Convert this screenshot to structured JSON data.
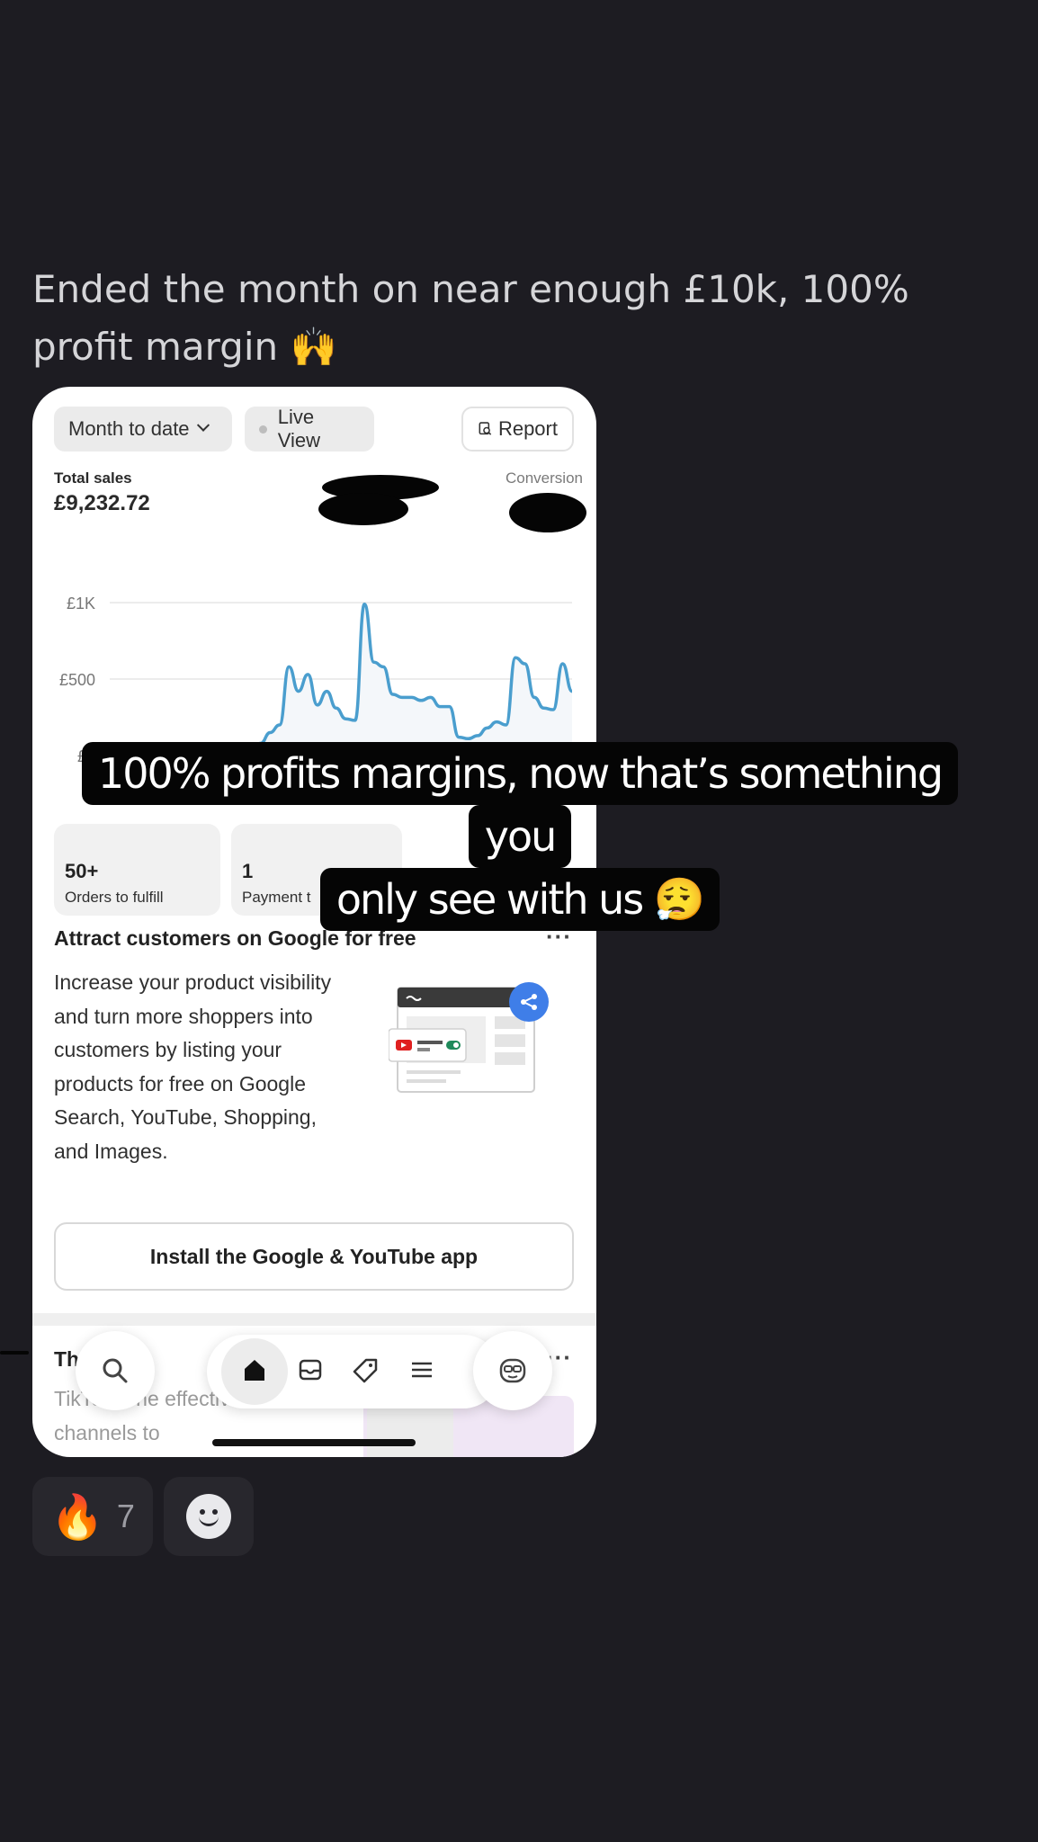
{
  "post": {
    "text": "Ended the month on near enough £10k, 100% profit margin 🙌"
  },
  "dashboard": {
    "filters": {
      "period_label": "Month to date",
      "live_label": "Live View",
      "report_label": "Report"
    },
    "total_sales_label": "Total sales",
    "total_sales_value": "£9,232.72",
    "conversion_label": "Conversion",
    "stats": [
      {
        "value": "50+",
        "label": "Orders to fulfill"
      },
      {
        "value": "1",
        "label": "Payment t"
      }
    ],
    "attract_card": {
      "title": "Attract customers on Google for free",
      "more": "···",
      "body": "Increase your product visibility and turn more shoppers into customers by listing your products for free on Google Search, YouTube, Shopping, and Images.",
      "button_label": "Install the Google & YouTube app"
    },
    "tiktok_card": {
      "title": "Th",
      "body": "TikTo s one   effective social channels to"
    },
    "tabs": [
      "search-icon",
      "home-icon",
      "inbox-icon",
      "tag-icon",
      "menu-icon",
      "avatar-icon"
    ]
  },
  "chart_data": {
    "type": "line",
    "title": "",
    "xlabel": "",
    "ylabel": "",
    "y_ticks": [
      "£0",
      "£500",
      "£1K"
    ],
    "ylim": [
      0,
      1000
    ],
    "grid": true,
    "series": [
      {
        "color": "#4a9ece",
        "values": [
          0,
          0,
          0,
          0,
          0,
          0,
          0,
          0,
          0,
          0,
          10,
          20,
          30,
          20,
          30,
          50,
          80,
          150,
          200,
          580,
          420,
          530,
          330,
          420,
          310,
          240,
          230,
          990,
          610,
          580,
          400,
          380,
          380,
          360,
          380,
          320,
          320,
          120,
          110,
          130,
          180,
          220,
          200,
          640,
          600,
          380,
          310,
          300,
          600,
          420
        ]
      }
    ],
    "line_color": "#4a9ece",
    "baseline_color": "#a9a9a9"
  },
  "caption": {
    "line1": "100% profits margins, now that’s something you",
    "line2": "only see with us 😮‍💨"
  },
  "reactions": {
    "fire_emoji": "🔥",
    "fire_count": "7",
    "add_reaction_icon": "smiley-add-reaction-icon"
  }
}
